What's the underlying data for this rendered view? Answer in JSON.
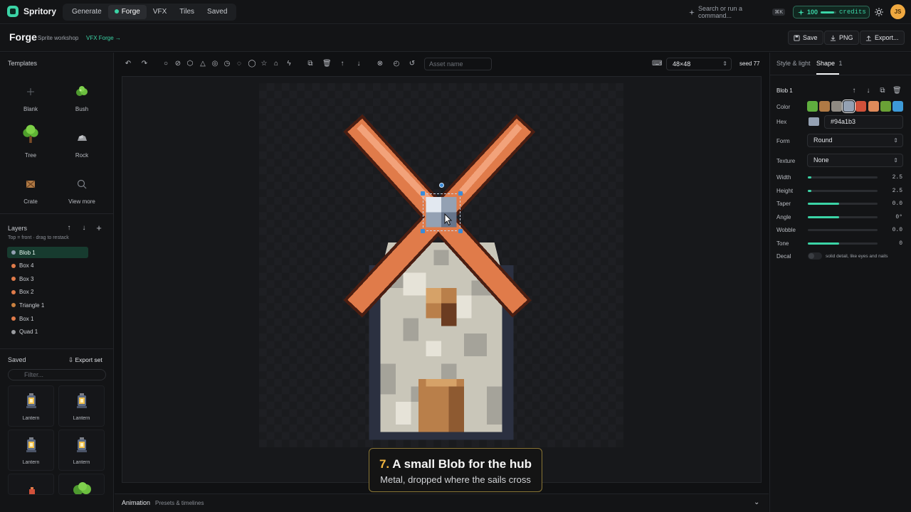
{
  "app": {
    "name": "Spritory"
  },
  "nav": {
    "tabs": [
      "Generate",
      "Forge",
      "VFX",
      "Tiles",
      "Saved"
    ],
    "active": "Forge"
  },
  "search": {
    "placeholder": "Search or run a command...",
    "shortcut": "⌘K"
  },
  "credits": {
    "value": "100",
    "label": "credits",
    "fill": 0.85
  },
  "user": {
    "initials": "JS"
  },
  "page": {
    "title": "Forge",
    "subtitle": "Sprite workshop",
    "link": "VFX Forge →"
  },
  "header_buttons": {
    "save": "Save",
    "png": "PNG",
    "export": "Export..."
  },
  "templates": {
    "title": "Templates",
    "items": [
      {
        "label": "Blank",
        "icon": "plus-icon"
      },
      {
        "label": "Bush",
        "icon": "bush-icon"
      },
      {
        "label": "Tree",
        "icon": "tree-icon"
      },
      {
        "label": "Rock",
        "icon": "rock-icon"
      },
      {
        "label": "Crate",
        "icon": "crate-icon"
      },
      {
        "label": "View more",
        "icon": "search-icon"
      }
    ]
  },
  "layers": {
    "title": "Layers",
    "hint": "Top = front · drag to restack",
    "items": [
      {
        "label": "Blob 1",
        "color": "#94a1b3",
        "selected": true
      },
      {
        "label": "Box 4",
        "color": "#e07b4a"
      },
      {
        "label": "Box 3",
        "color": "#e07b4a"
      },
      {
        "label": "Box 2",
        "color": "#e07b4a"
      },
      {
        "label": "Triangle 1",
        "color": "#c9803f"
      },
      {
        "label": "Box 1",
        "color": "#e07b4a"
      },
      {
        "label": "Quad 1",
        "color": "#9a9ca0"
      }
    ]
  },
  "saved": {
    "title": "Saved",
    "export_label": "Export set",
    "filter_placeholder": "Filter...",
    "items": [
      {
        "label": "Lantern"
      },
      {
        "label": "Lantern"
      },
      {
        "label": "Lantern"
      },
      {
        "label": "Lantern"
      }
    ]
  },
  "toolbar": {
    "asset_placeholder": "Asset name",
    "size": "48×48",
    "seed": "seed 77"
  },
  "caption": {
    "number": "7.",
    "title": "A small Blob for the hub",
    "subtitle": "Metal, dropped where the sails cross"
  },
  "animation": {
    "title": "Animation",
    "subtitle": "Presets & timelines"
  },
  "inspector": {
    "tabs": {
      "style": "Style & light",
      "shape": "Shape",
      "shape_count": "1"
    },
    "shape_name": "Blob 1",
    "labels": {
      "color": "Color",
      "hex": "Hex",
      "form": "Form",
      "texture": "Texture"
    },
    "swatches": [
      "#5fae3e",
      "#b07a45",
      "#8f8a82",
      "#94a1b3",
      "#d1513a",
      "#df8a5a",
      "#6aa136",
      "#3d9ad8"
    ],
    "hex_value": "#94a1b3",
    "form_value": "Round",
    "texture_value": "None",
    "sliders": [
      {
        "label": "Width",
        "value": "2.5",
        "fill": 0.05
      },
      {
        "label": "Height",
        "value": "2.5",
        "fill": 0.05
      },
      {
        "label": "Taper",
        "value": "0.0",
        "fill": 0.45
      },
      {
        "label": "Angle",
        "value": "0°",
        "fill": 0.45
      },
      {
        "label": "Wobble",
        "value": "0.0",
        "fill": 0.0
      },
      {
        "label": "Tone",
        "value": "0",
        "fill": 0.45
      }
    ],
    "decal": {
      "label": "Decal",
      "hint": "solid detail, like eyes and nails"
    }
  }
}
